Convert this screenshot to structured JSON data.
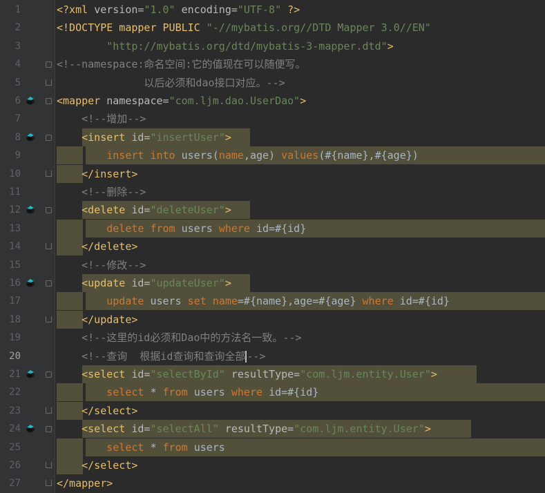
{
  "editor": {
    "language": "xml",
    "current_line": 20,
    "lines": [
      {
        "n": "1",
        "segs": [
          [
            "tag",
            "<?xml "
          ],
          [
            "attr",
            "version="
          ],
          [
            "str",
            "\"1.0\""
          ],
          [
            "attr",
            " encoding="
          ],
          [
            "str",
            "\"UTF-8\""
          ],
          [
            "tag",
            " ?>"
          ]
        ]
      },
      {
        "n": "2",
        "segs": [
          [
            "tag",
            "<!DOCTYPE mapper PUBLIC "
          ],
          [
            "str",
            "\"-//mybatis.org//DTD Mapper 3.0//EN\""
          ]
        ]
      },
      {
        "n": "3",
        "segs": [
          [
            "plain",
            "        "
          ],
          [
            "str",
            "\"http://mybatis.org/dtd/mybatis-3-mapper.dtd\""
          ],
          [
            "tag",
            ">"
          ]
        ]
      },
      {
        "n": "4",
        "segs": [
          [
            "cmt",
            "<!--namespace:命名空间:它的值现在可以随便写。"
          ]
        ]
      },
      {
        "n": "5",
        "segs": [
          [
            "cmt",
            "              以后必须和dao接口对应。-->"
          ]
        ]
      },
      {
        "n": "6",
        "segs": [
          [
            "tag",
            "<mapper "
          ],
          [
            "attr",
            "namespace="
          ],
          [
            "str",
            "\"com.ljm.dao.UserDao\""
          ],
          [
            "tag",
            ">"
          ]
        ]
      },
      {
        "n": "7",
        "segs": [
          [
            "plain",
            "    "
          ],
          [
            "cmt",
            "<!--增加-->"
          ]
        ]
      },
      {
        "n": "8",
        "segs": [
          [
            "plain",
            "    "
          ],
          [
            "tag",
            "<insert "
          ],
          [
            "attr",
            "id="
          ],
          [
            "str",
            "\"insertUser\""
          ],
          [
            "tag",
            ">"
          ]
        ]
      },
      {
        "n": "9",
        "segs": [
          [
            "plain",
            "        "
          ],
          [
            "kw",
            "insert into "
          ],
          [
            "plain",
            "users("
          ],
          [
            "kw",
            "name"
          ],
          [
            "plain",
            ",age) "
          ],
          [
            "kw",
            "values"
          ],
          [
            "plain",
            "(#{name},#{age})"
          ]
        ]
      },
      {
        "n": "10",
        "segs": [
          [
            "plain",
            "    "
          ],
          [
            "tag",
            "</insert>"
          ]
        ]
      },
      {
        "n": "11",
        "segs": [
          [
            "plain",
            "    "
          ],
          [
            "cmt",
            "<!--删除-->"
          ]
        ]
      },
      {
        "n": "12",
        "segs": [
          [
            "plain",
            "    "
          ],
          [
            "tag",
            "<delete "
          ],
          [
            "attr",
            "id="
          ],
          [
            "str",
            "\"deleteUser\""
          ],
          [
            "tag",
            ">"
          ]
        ]
      },
      {
        "n": "13",
        "segs": [
          [
            "plain",
            "        "
          ],
          [
            "kw",
            "delete from "
          ],
          [
            "plain",
            "users "
          ],
          [
            "kw",
            "where "
          ],
          [
            "plain",
            "id=#{id}"
          ]
        ]
      },
      {
        "n": "14",
        "segs": [
          [
            "plain",
            "    "
          ],
          [
            "tag",
            "</delete>"
          ]
        ]
      },
      {
        "n": "15",
        "segs": [
          [
            "plain",
            "    "
          ],
          [
            "cmt",
            "<!--修改-->"
          ]
        ]
      },
      {
        "n": "16",
        "segs": [
          [
            "plain",
            "    "
          ],
          [
            "tag",
            "<update "
          ],
          [
            "attr",
            "id="
          ],
          [
            "str",
            "\"updateUser\""
          ],
          [
            "tag",
            ">"
          ]
        ]
      },
      {
        "n": "17",
        "segs": [
          [
            "plain",
            "        "
          ],
          [
            "kw",
            "update "
          ],
          [
            "plain",
            "users "
          ],
          [
            "kw",
            "set name"
          ],
          [
            "plain",
            "=#{name},age=#{age} "
          ],
          [
            "kw",
            "where "
          ],
          [
            "plain",
            "id=#{id}"
          ]
        ]
      },
      {
        "n": "18",
        "segs": [
          [
            "plain",
            "    "
          ],
          [
            "tag",
            "</update>"
          ]
        ]
      },
      {
        "n": "19",
        "segs": [
          [
            "plain",
            "    "
          ],
          [
            "cmt",
            "<!--这里的id必须和Dao中的方法名一致。-->"
          ]
        ]
      },
      {
        "n": "20",
        "segs": [
          [
            "plain",
            "    "
          ],
          [
            "cmt",
            "<!--查询  根据id查询和查询全部"
          ],
          [
            "caret",
            ""
          ],
          [
            "cmt",
            "-->"
          ]
        ]
      },
      {
        "n": "21",
        "segs": [
          [
            "plain",
            "    "
          ],
          [
            "tag",
            "<select "
          ],
          [
            "attr",
            "id="
          ],
          [
            "str",
            "\"selectById\""
          ],
          [
            "attr",
            " resultType="
          ],
          [
            "str",
            "\"com.ljm.entity.User\""
          ],
          [
            "tag",
            ">"
          ]
        ]
      },
      {
        "n": "22",
        "segs": [
          [
            "plain",
            "        "
          ],
          [
            "kw",
            "select "
          ],
          [
            "plain",
            "* "
          ],
          [
            "kw",
            "from "
          ],
          [
            "plain",
            "users "
          ],
          [
            "kw",
            "where "
          ],
          [
            "plain",
            "id=#{id}"
          ]
        ]
      },
      {
        "n": "23",
        "segs": [
          [
            "plain",
            "    "
          ],
          [
            "tag",
            "</select>"
          ]
        ]
      },
      {
        "n": "24",
        "segs": [
          [
            "plain",
            "    "
          ],
          [
            "tag",
            "<select "
          ],
          [
            "attr",
            "id="
          ],
          [
            "str",
            "\"selectAll\""
          ],
          [
            "attr",
            " resultType="
          ],
          [
            "str",
            "\"com.ljm.entity.User\""
          ],
          [
            "tag",
            ">"
          ]
        ]
      },
      {
        "n": "25",
        "segs": [
          [
            "plain",
            "        "
          ],
          [
            "kw",
            "select "
          ],
          [
            "plain",
            "* "
          ],
          [
            "kw",
            "from "
          ],
          [
            "plain",
            "users"
          ]
        ]
      },
      {
        "n": "26",
        "segs": [
          [
            "plain",
            "    "
          ],
          [
            "tag",
            "</select>"
          ]
        ]
      },
      {
        "n": "27",
        "segs": [
          [
            "tag",
            "</mapper>"
          ]
        ]
      }
    ]
  }
}
